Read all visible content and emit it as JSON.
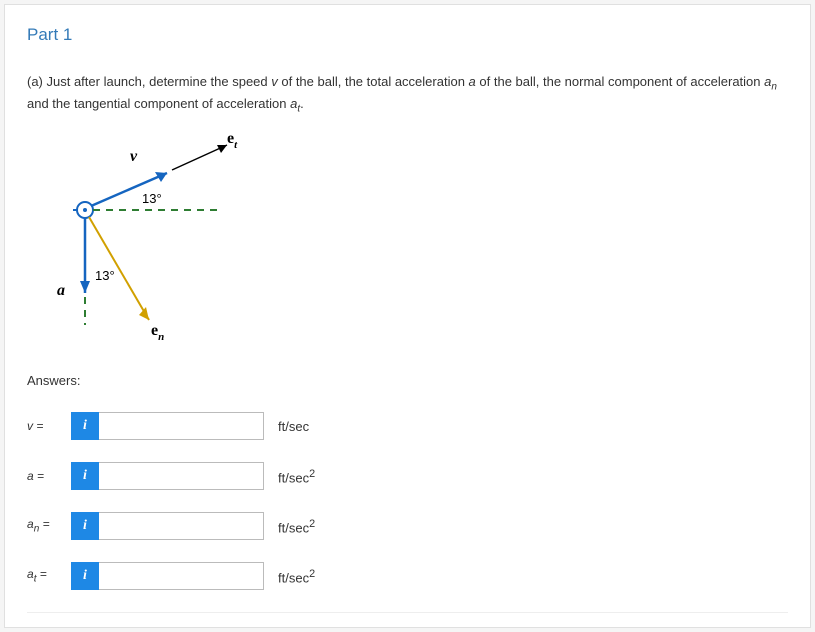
{
  "part_title": "Part 1",
  "question": {
    "prefix": "(a) Just after launch, determine the speed ",
    "v": "v",
    "mid1": " of the ball, the total acceleration ",
    "a": "a",
    "mid2": " of the ball, the normal component of acceleration ",
    "an": "a",
    "an_sub": "n",
    "mid3": " and the tangential component of acceleration ",
    "at": "a",
    "at_sub": "t",
    "suffix": "."
  },
  "diagram": {
    "angle_upper": "13°",
    "angle_lower": "13°",
    "v_label": "v",
    "a_label": "a",
    "et_label": "e",
    "et_sub": "t",
    "en_label": "e",
    "en_sub": "n"
  },
  "answers_heading": "Answers:",
  "info_icon": "i",
  "rows": [
    {
      "var": "v",
      "sub": "",
      "equals": " =",
      "unit": "ft/sec"
    },
    {
      "var": "a",
      "sub": "",
      "equals": " =",
      "unit_html": "ft/sec",
      "sup": "2"
    },
    {
      "var": "a",
      "sub": "n",
      "equals": " =",
      "unit_html": "ft/sec",
      "sup": "2"
    },
    {
      "var": "a",
      "sub": "t",
      "equals": " =",
      "unit_html": "ft/sec",
      "sup": "2"
    }
  ]
}
